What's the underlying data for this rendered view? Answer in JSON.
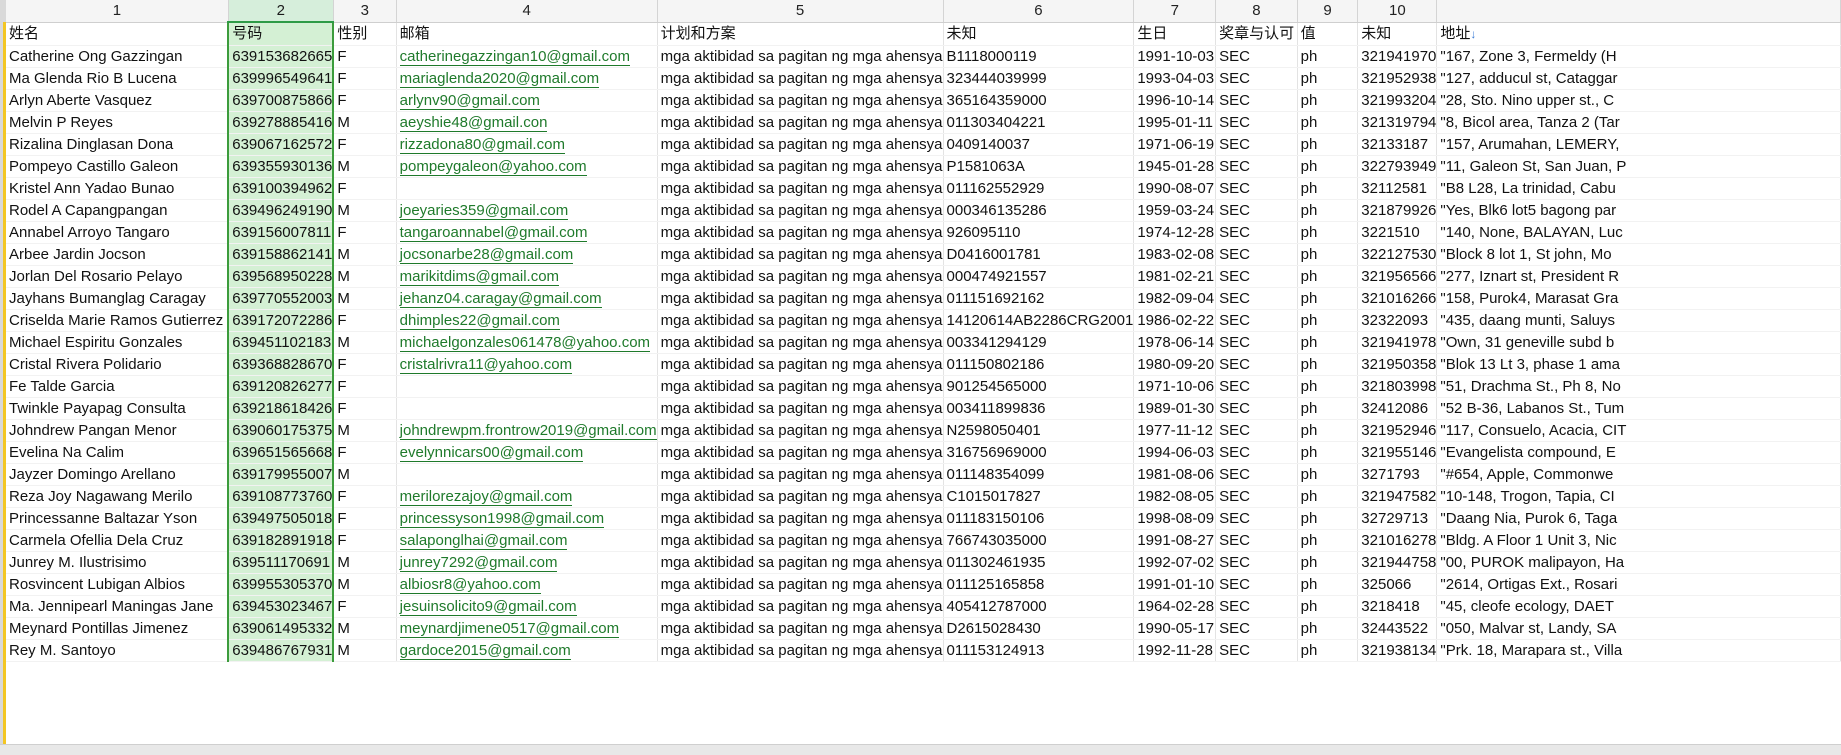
{
  "column_numbers": [
    "1",
    "2",
    "3",
    "4",
    "5",
    "6",
    "7",
    "8",
    "9",
    "10",
    ""
  ],
  "headers": [
    "姓名",
    "号码",
    "性别",
    "邮箱",
    "计划和方案",
    "未知",
    "生日",
    "奖章与认可",
    "值",
    "未知",
    "地址"
  ],
  "sort_icon": "↓",
  "rows": [
    [
      "Catherine Ong Gazzingan",
      "639153682665",
      "F",
      "catherinegazzingan10@gmail.com",
      "mga aktibidad sa pagitan ng mga ahensya",
      "B1118000119",
      "1991-10-03",
      "SEC",
      "ph",
      "321941970",
      "\"167, Zone 3, Fermeldy (H"
    ],
    [
      "Ma Glenda Rio B Lucena",
      "639996549641",
      "F",
      "mariaglenda2020@gmail.com",
      "mga aktibidad sa pagitan ng mga ahensya",
      "323444039999",
      "1993-04-03",
      "SEC",
      "ph",
      "321952938",
      "\"127, adducul st, Cataggar"
    ],
    [
      "Arlyn Aberte Vasquez",
      "639700875866",
      "F",
      "arlynv90@gmail.com",
      "mga aktibidad sa pagitan ng mga ahensya",
      "365164359000",
      "1996-10-14",
      "SEC",
      "ph",
      "321993204",
      "\"28, Sto. Nino upper st., C"
    ],
    [
      "Melvin P Reyes",
      "639278885416",
      "M",
      "aeyshie48@gmail.con",
      "mga aktibidad sa pagitan ng mga ahensya",
      "011303404221",
      "1995-01-11",
      "SEC",
      "ph",
      "321319794",
      "\"8, Bicol area, Tanza 2 (Tar"
    ],
    [
      "Rizalina Dinglasan Dona",
      "639067162572",
      "F",
      "rizzadona80@gmail.com",
      "mga aktibidad sa pagitan ng mga ahensya",
      "0409140037",
      "1971-06-19",
      "SEC",
      "ph",
      "32133187",
      "\"157, Arumahan, LEMERY,"
    ],
    [
      "Pompeyo Castillo Galeon",
      "639355930136",
      "M",
      "pompeygaleon@yahoo.com",
      "mga aktibidad sa pagitan ng mga ahensya",
      "P1581063A",
      "1945-01-28",
      "SEC",
      "ph",
      "322793949",
      "\"11, Galeon St, San Juan, P"
    ],
    [
      "Kristel Ann Yadao Bunao",
      "639100394962",
      "F",
      "",
      "mga aktibidad sa pagitan ng mga ahensya",
      "011162552929",
      "1990-08-07",
      "SEC",
      "ph",
      "32112581",
      "\"B8 L28, La trinidad, Cabu"
    ],
    [
      "Rodel A Capangpangan",
      "639496249190",
      "M",
      "joeyaries359@gmail.com",
      "mga aktibidad sa pagitan ng mga ahensya",
      "000346135286",
      "1959-03-24",
      "SEC",
      "ph",
      "321879926",
      "\"Yes, Blk6 lot5 bagong par"
    ],
    [
      "Annabel Arroyo Tangaro",
      "639156007811",
      "F",
      "tangaroannabel@gmail.com",
      "mga aktibidad sa pagitan ng mga ahensya",
      "926095110",
      "1974-12-28",
      "SEC",
      "ph",
      "3221510",
      "\"140, None, BALAYAN, Luc"
    ],
    [
      "Arbee Jardin Jocson",
      "639158862141",
      "M",
      "jocsonarbe28@gmail.com",
      "mga aktibidad sa pagitan ng mga ahensya",
      "D0416001781",
      "1983-02-08",
      "SEC",
      "ph",
      "322127530",
      "\"Block 8 lot 1, St john, Mo"
    ],
    [
      "Jorlan Del Rosario Pelayo",
      "639568950228",
      "M",
      "marikitdims@gmail.com",
      "mga aktibidad sa pagitan ng mga ahensya",
      "000474921557",
      "1981-02-21",
      "SEC",
      "ph",
      "321956566",
      "\"277, Iznart st, President R"
    ],
    [
      "Jayhans Bumanglag Caragay",
      "639770552003",
      "M",
      "jehanz04.caragay@gmail.com",
      "mga aktibidad sa pagitan ng mga ahensya",
      "011151692162",
      "1982-09-04",
      "SEC",
      "ph",
      "321016266",
      "\"158, Purok4, Marasat Gra"
    ],
    [
      "Criselda Marie Ramos Gutierrez",
      "639172072286",
      "F",
      "dhimples22@gmail.com",
      "mga aktibidad sa pagitan ng mga ahensya",
      "14120614AB2286CRG2001",
      "1986-02-22",
      "SEC",
      "ph",
      "32322093",
      "\"435, daang munti, Saluys"
    ],
    [
      "Michael Espiritu Gonzales",
      "639451102183",
      "M",
      "michaelgonzales061478@yahoo.com",
      "mga aktibidad sa pagitan ng mga ahensya",
      "003341294129",
      "1978-06-14",
      "SEC",
      "ph",
      "321941978",
      "\"Own, 31 geneville subd b"
    ],
    [
      "Cristal Rivera Polidario",
      "639368828670",
      "F",
      "cristalrivra11@yahoo.com",
      "mga aktibidad sa pagitan ng mga ahensya",
      "011150802186",
      "1980-09-20",
      "SEC",
      "ph",
      "321950358",
      "\"Blok 13 Lt 3, phase 1 ama"
    ],
    [
      "Fe Talde Garcia",
      "639120826277",
      "F",
      "",
      "mga aktibidad sa pagitan ng mga ahensya",
      "901254565000",
      "1971-10-06",
      "SEC",
      "ph",
      "321803998",
      "\"51, Drachma St., Ph 8, No"
    ],
    [
      "Twinkle Payapag Consulta",
      "639218618426",
      "F",
      "",
      "mga aktibidad sa pagitan ng mga ahensya",
      "003411899836",
      "1989-01-30",
      "SEC",
      "ph",
      "32412086",
      "\"52 B-36, Labanos St., Tum"
    ],
    [
      "Johndrew Pangan Menor",
      "639060175375",
      "M",
      "johndrewpm.frontrow2019@gmail.com",
      "mga aktibidad sa pagitan ng mga ahensya",
      "N2598050401",
      "1977-11-12",
      "SEC",
      "ph",
      "321952946",
      "\"117, Consuelo, Acacia, CIT"
    ],
    [
      "Evelina Na Calim",
      "639651565668",
      "F",
      "evelynnicars00@gmail.com",
      "mga aktibidad sa pagitan ng mga ahensya",
      "316756969000",
      "1994-06-03",
      "SEC",
      "ph",
      "321955146",
      "\"Evangelista compound, E"
    ],
    [
      "Jayzer Domingo Arellano",
      "639179955007",
      "M",
      "",
      "mga aktibidad sa pagitan ng mga ahensya",
      "011148354099",
      "1981-08-06",
      "SEC",
      "ph",
      "3271793",
      "\"#654, Apple, Commonwe"
    ],
    [
      "Reza Joy Nagawang Merilo",
      "639108773760",
      "F",
      "merilorezajoy@gmail.com",
      "mga aktibidad sa pagitan ng mga ahensya",
      "C1015017827",
      "1982-08-05",
      "SEC",
      "ph",
      "321947582",
      "\"10-148, Trogon, Tapia, CI"
    ],
    [
      "Princessanne Baltazar Yson",
      "639497505018",
      "F",
      "princessyson1998@gmail.com",
      "mga aktibidad sa pagitan ng mga ahensya",
      "011183150106",
      "1998-08-09",
      "SEC",
      "ph",
      "32729713",
      "\"Daang Nia, Purok 6, Taga"
    ],
    [
      "Carmela Ofellia Dela Cruz",
      "639182891918",
      "F",
      "salaponglhai@gmail.com",
      "mga aktibidad sa pagitan ng mga ahensya",
      "766743035000",
      "1991-08-27",
      "SEC",
      "ph",
      "321016278",
      "\"Bldg. A Floor 1 Unit 3, Nic"
    ],
    [
      "Junrey M. Ilustrisimo",
      "639511170691",
      "M",
      "junrey7292@gmail.com",
      "mga aktibidad sa pagitan ng mga ahensya",
      "011302461935",
      "1992-07-02",
      "SEC",
      "ph",
      "321944758",
      "\"00, PUROK malipayon, Ha"
    ],
    [
      "Rosvincent Lubigan Albios",
      "639955305370",
      "M",
      "albiosr8@yahoo.com",
      "mga aktibidad sa pagitan ng mga ahensya",
      "011125165858",
      "1991-01-10",
      "SEC",
      "ph",
      "325066",
      "\"2614, Ortigas Ext., Rosari"
    ],
    [
      "Ma. Jennipearl Maningas Jane",
      "639453023467",
      "F",
      "jesuinsolicito9@gmail.com",
      "mga aktibidad sa pagitan ng mga ahensya",
      "405412787000",
      "1964-02-28",
      "SEC",
      "ph",
      "3218418",
      "\"45, cleofe ecology, DAET"
    ],
    [
      "Meynard Pontillas Jimenez",
      "639061495332",
      "M",
      "meynardjimene0517@gmail.com",
      "mga aktibidad sa pagitan ng mga ahensya",
      "D2615028430",
      "1990-05-17",
      "SEC",
      "ph",
      "32443522",
      "\"050, Malvar st, Landy, SA"
    ],
    [
      "Rey M. Santoyo",
      "639486767931",
      "M",
      "gardoce2015@gmail.com",
      "mga aktibidad sa pagitan ng mga ahensya",
      "011153124913",
      "1992-11-28",
      "SEC",
      "ph",
      "321938134",
      "\"Prk. 18, Marapara st., Villa"
    ]
  ]
}
